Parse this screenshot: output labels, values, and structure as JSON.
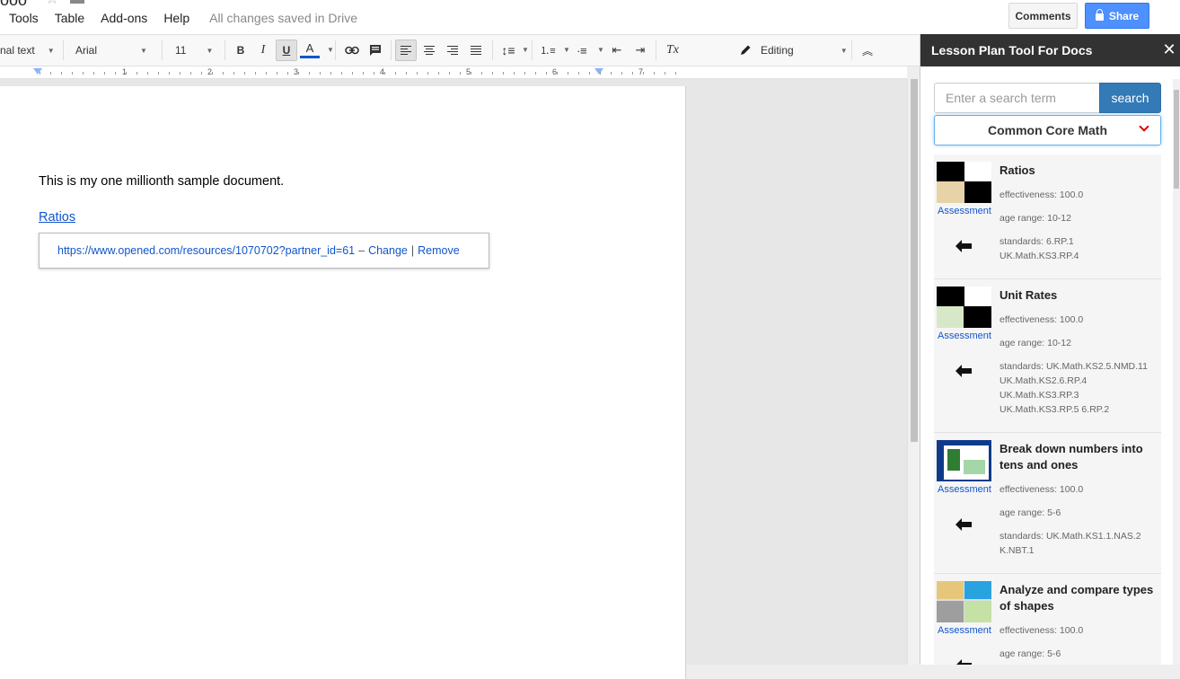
{
  "document": {
    "title_fragment": "ooo"
  },
  "menu": {
    "items": [
      "Tools",
      "Table",
      "Add-ons",
      "Help"
    ],
    "save_status": "All changes saved in Drive"
  },
  "header": {
    "comments_label": "Comments",
    "share_label": "Share"
  },
  "toolbar": {
    "style_label": "nal text",
    "font_label": "Arial",
    "size_label": "11",
    "bold_label": "B",
    "italic_label": "I",
    "underline_label": "U",
    "color_label": "A",
    "mode_label": "Editing",
    "clear_label": "Tx"
  },
  "ruler": {
    "numbers": [
      "1",
      "2",
      "3",
      "4",
      "5",
      "6",
      "7"
    ]
  },
  "page": {
    "body_text": "This is my one millionth sample document.",
    "link_text": "Ratios",
    "bubble": {
      "url": "https://www.opened.com/resources/1070702?partner_id=61",
      "dash": "–",
      "change_label": "Change",
      "sep": "|",
      "remove_label": "Remove"
    }
  },
  "sidebar": {
    "title": "Lesson Plan Tool For Docs",
    "search_placeholder": "Enter a search term",
    "search_label": "search",
    "selected_standard": "Common Core Math",
    "results": [
      {
        "title": "Ratios",
        "category": "Assessment",
        "effectiveness": "effectiveness: 100.0",
        "age": "age range: 10-12",
        "standards": [
          "standards: 6.RP.1",
          "UK.Math.KS3.RP.4"
        ]
      },
      {
        "title": "Unit Rates",
        "category": "Assessment",
        "effectiveness": "effectiveness: 100.0",
        "age": "age range: 10-12",
        "standards": [
          "standards: UK.Math.KS2.5.NMD.11",
          "UK.Math.KS2.6.RP.4",
          "UK.Math.KS3.RP.3",
          "UK.Math.KS3.RP.5 6.RP.2"
        ]
      },
      {
        "title": "Break down numbers into tens and ones",
        "category": "Assessment",
        "effectiveness": "effectiveness: 100.0",
        "age": "age range: 5-6",
        "standards": [
          "standards: UK.Math.KS1.1.NAS.2",
          "K.NBT.1"
        ]
      },
      {
        "title": "Analyze and compare types of shapes",
        "category": "Assessment",
        "effectiveness": "effectiveness: 100.0",
        "age": "age range: 5-6",
        "standards": []
      }
    ]
  }
}
